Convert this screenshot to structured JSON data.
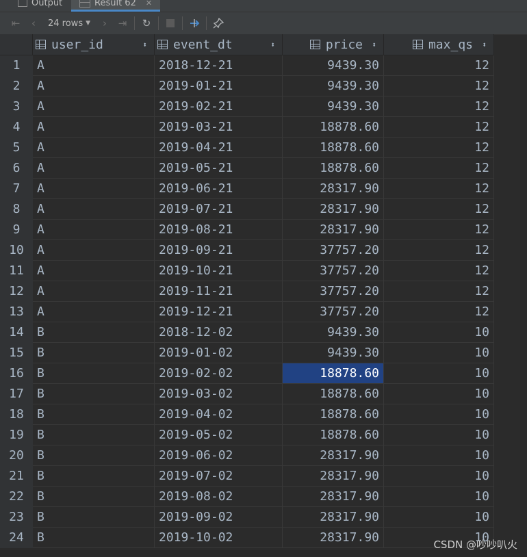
{
  "tabs": [
    {
      "label": "Output",
      "active": false
    },
    {
      "label": "Result 62",
      "active": true
    }
  ],
  "toolbar": {
    "rows_label": "24 rows"
  },
  "columns": [
    "user_id",
    "event_dt",
    "price",
    "max_qs"
  ],
  "rows": [
    [
      "1",
      "A",
      "2018-12-21",
      "9439.30",
      "12"
    ],
    [
      "2",
      "A",
      "2019-01-21",
      "9439.30",
      "12"
    ],
    [
      "3",
      "A",
      "2019-02-21",
      "9439.30",
      "12"
    ],
    [
      "4",
      "A",
      "2019-03-21",
      "18878.60",
      "12"
    ],
    [
      "5",
      "A",
      "2019-04-21",
      "18878.60",
      "12"
    ],
    [
      "6",
      "A",
      "2019-05-21",
      "18878.60",
      "12"
    ],
    [
      "7",
      "A",
      "2019-06-21",
      "28317.90",
      "12"
    ],
    [
      "8",
      "A",
      "2019-07-21",
      "28317.90",
      "12"
    ],
    [
      "9",
      "A",
      "2019-08-21",
      "28317.90",
      "12"
    ],
    [
      "10",
      "A",
      "2019-09-21",
      "37757.20",
      "12"
    ],
    [
      "11",
      "A",
      "2019-10-21",
      "37757.20",
      "12"
    ],
    [
      "12",
      "A",
      "2019-11-21",
      "37757.20",
      "12"
    ],
    [
      "13",
      "A",
      "2019-12-21",
      "37757.20",
      "12"
    ],
    [
      "14",
      "B",
      "2018-12-02",
      "9439.30",
      "10"
    ],
    [
      "15",
      "B",
      "2019-01-02",
      "9439.30",
      "10"
    ],
    [
      "16",
      "B",
      "2019-02-02",
      "18878.60",
      "10"
    ],
    [
      "17",
      "B",
      "2019-03-02",
      "18878.60",
      "10"
    ],
    [
      "18",
      "B",
      "2019-04-02",
      "18878.60",
      "10"
    ],
    [
      "19",
      "B",
      "2019-05-02",
      "18878.60",
      "10"
    ],
    [
      "20",
      "B",
      "2019-06-02",
      "28317.90",
      "10"
    ],
    [
      "21",
      "B",
      "2019-07-02",
      "28317.90",
      "10"
    ],
    [
      "22",
      "B",
      "2019-08-02",
      "28317.90",
      "10"
    ],
    [
      "23",
      "B",
      "2019-09-02",
      "28317.90",
      "10"
    ],
    [
      "24",
      "B",
      "2019-10-02",
      "28317.90",
      "10"
    ]
  ],
  "selected_cell": {
    "row": 16,
    "column": "price"
  },
  "watermark": "CSDN @吵吵叭火",
  "colors": {
    "background": "#2b2b2b",
    "selection": "#214283",
    "header": "#313335"
  }
}
